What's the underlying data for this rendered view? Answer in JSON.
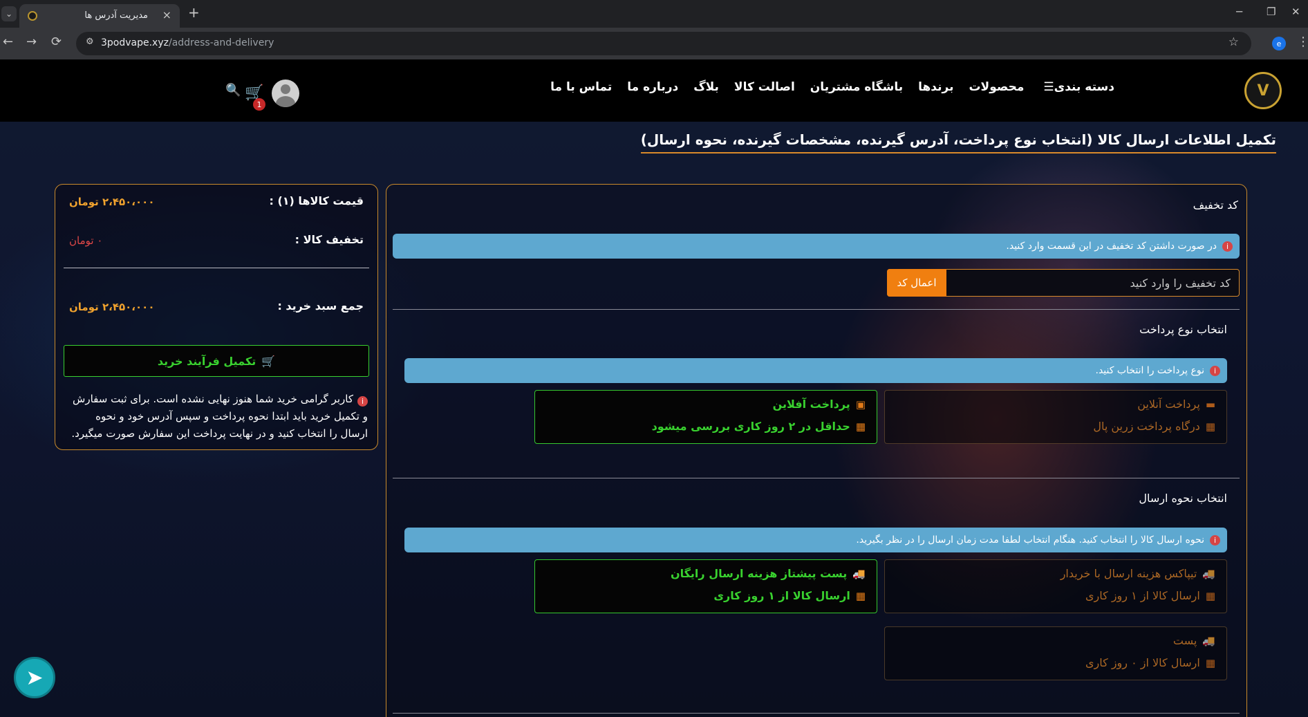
{
  "browser": {
    "tab_title": "مدیریت آدرس ها",
    "tab_close": "×",
    "new_tab": "+",
    "tab_list": "⌄",
    "url_domain": "3podvape.xyz",
    "url_path": "/address-and-delivery",
    "back": "←",
    "forward": "→",
    "reload": "⟳",
    "site_info": "⚙",
    "star": "☆",
    "extension_letter": "e",
    "menu": "⋮",
    "minimize": "─",
    "restore": "❐",
    "close": "✕"
  },
  "header": {
    "logo_text": "V",
    "nav": [
      {
        "label": "دسته بندی",
        "icon": "bars-icon"
      },
      {
        "label": "محصولات"
      },
      {
        "label": "برندها"
      },
      {
        "label": "باشگاه مشتریان"
      },
      {
        "label": "اصالت کالا"
      },
      {
        "label": "بلاگ"
      },
      {
        "label": "درباره ما"
      },
      {
        "label": "تماس با ما"
      }
    ],
    "cart_count": "1",
    "cart_icon": "🛒",
    "search_icon": "🔍",
    "bars_glyph": "☰"
  },
  "page_title": "تکمیل اطلاعات ارسال کالا (انتخاب نوع پرداخت، آدرس گیرنده، مشخصات گیرنده، نحوه ارسال)",
  "coupon": {
    "title": "کد تخفیف",
    "alert": "در صورت داشتن کد تخفیف در این قسمت وارد کنید.",
    "placeholder": "کد تخفیف را وارد کنید",
    "apply_label": "اعمال کد"
  },
  "payment": {
    "title": "انتخاب نوع پرداخت",
    "alert": "نوع پرداخت را انتخاب کنید.",
    "options": [
      {
        "title": "پرداخت آنلاین",
        "subtitle": "درگاه پرداخت زرین پال",
        "state": "disabled",
        "icon": "credit-card-icon",
        "glyph": "▬"
      },
      {
        "title": "پرداخت آفلاین",
        "subtitle": "حداقل در ۲ روز کاری بررسی میشود",
        "state": "selected",
        "icon": "cash-icon",
        "glyph": "▣"
      }
    ]
  },
  "shipping": {
    "title": "انتخاب نحوه ارسال",
    "alert": "نحوه ارسال کالا را انتخاب کنید. هنگام انتخاب لطفا مدت زمان ارسال را در نظر بگیرید.",
    "options": [
      {
        "title": "تیپاکس هزینه ارسال با خریدار",
        "subtitle": "ارسال کالا از ۱ روز کاری",
        "state": "disabled",
        "icon": "truck-icon",
        "glyph": "🚚"
      },
      {
        "title": "پست پیشتاز هزینه ارسال رایگان",
        "subtitle": "ارسال کالا از ۱ روز کاری",
        "state": "selected",
        "icon": "truck-icon",
        "glyph": "🚚"
      },
      {
        "title": "پست",
        "subtitle": "ارسال کالا از ۰ روز کاری",
        "state": "disabled",
        "icon": "truck-icon",
        "glyph": "🚚"
      }
    ],
    "calendar_glyph": "▦"
  },
  "summary": {
    "items_price_label": "قیمت کالاها (۱) :",
    "items_price_value": "۲،۴۵۰،۰۰۰ تومان",
    "discount_label": "تخفیف کالا :",
    "discount_value": "۰ تومان",
    "total_label": "جمع سبد خرید :",
    "total_value": "۲،۴۵۰،۰۰۰ تومان",
    "checkout_label": "تکمیل فرآیند خرید",
    "notice": "کاربر گرامی خرید شما هنوز نهایی نشده است. برای ثبت سفارش و تکمیل خرید باید ابتدا نحوه پرداخت و سپس آدرس خود و نحوه ارسال را انتخاب کنید و در نهایت پرداخت این سفارش صورت میگیرد."
  },
  "colors": {
    "accent_orange": "#f07f10",
    "active_green": "#39d12f",
    "alert_blue": "#5ea8d0",
    "price_orange": "#f0a22e",
    "discount_red": "#e04848"
  },
  "info_glyph": "i",
  "telegram_glyph": "➤"
}
